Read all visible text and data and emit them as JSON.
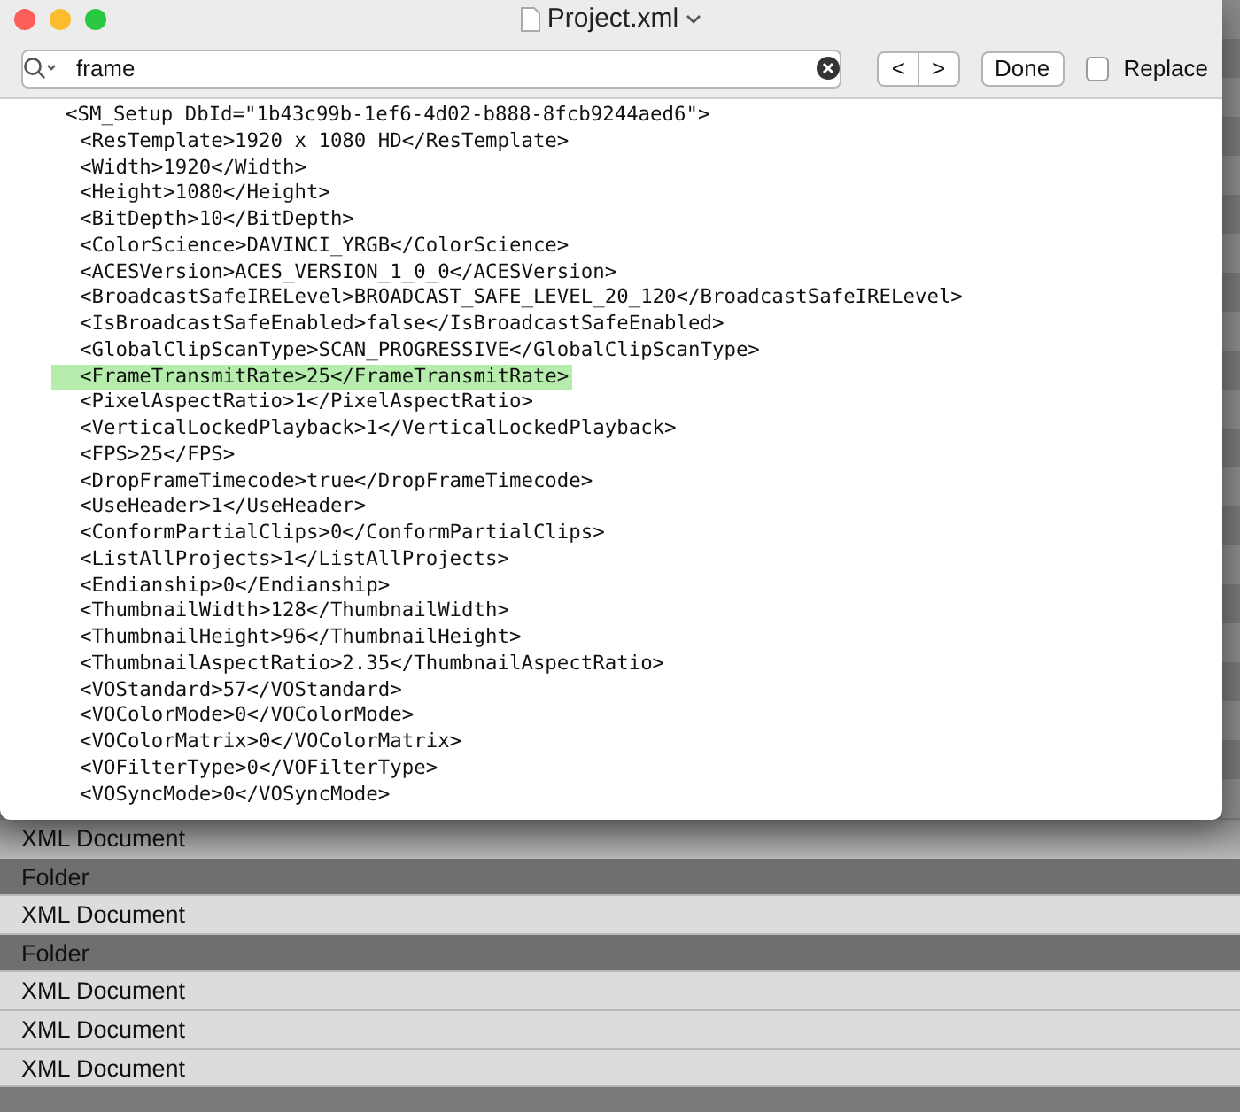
{
  "window": {
    "title": "Project.xml"
  },
  "find_bar": {
    "query": "frame",
    "replace_checked": false,
    "done_label": "Done",
    "replace_label": "Replace",
    "prev_label": "<",
    "next_label": ">"
  },
  "code_lines": [
    {
      "text": "<SM_Setup DbId=\"1b43c99b-1ef6-4d02-b888-8fcb9244aed6\">",
      "highlighted": false,
      "children": [
        {
          "text": "<ResTemplate>1920 x 1080 HD</ResTemplate>",
          "highlighted": false
        },
        {
          "text": "<Width>1920</Width>",
          "highlighted": false
        },
        {
          "text": "<Height>1080</Height>",
          "highlighted": false
        },
        {
          "text": "<BitDepth>10</BitDepth>",
          "highlighted": false
        },
        {
          "text": "<ColorScience>DAVINCI_YRGB</ColorScience>",
          "highlighted": false
        },
        {
          "text": "<ACESVersion>ACES_VERSION_1_0_0</ACESVersion>",
          "highlighted": false
        },
        {
          "text": "<BroadcastSafeIRELevel>BROADCAST_SAFE_LEVEL_20_120</BroadcastSafeIRELevel>",
          "highlighted": false
        },
        {
          "text": "<IsBroadcastSafeEnabled>false</IsBroadcastSafeEnabled>",
          "highlighted": false
        },
        {
          "text": "<GlobalClipScanType>SCAN_PROGRESSIVE</GlobalClipScanType>",
          "highlighted": false
        },
        {
          "text": "<FrameTransmitRate>25</FrameTransmitRate>",
          "highlighted": true
        },
        {
          "text": "<PixelAspectRatio>1</PixelAspectRatio>",
          "highlighted": false
        },
        {
          "text": "<VerticalLockedPlayback>1</VerticalLockedPlayback>",
          "highlighted": false
        },
        {
          "text": "<FPS>25</FPS>",
          "highlighted": false
        },
        {
          "text": "<DropFrameTimecode>true</DropFrameTimecode>",
          "highlighted": false
        },
        {
          "text": "<UseHeader>1</UseHeader>",
          "highlighted": false
        },
        {
          "text": "<ConformPartialClips>0</ConformPartialClips>",
          "highlighted": false
        },
        {
          "text": "<ListAllProjects>1</ListAllProjects>",
          "highlighted": false
        },
        {
          "text": "<Endianship>0</Endianship>",
          "highlighted": false
        },
        {
          "text": "<ThumbnailWidth>128</ThumbnailWidth>",
          "highlighted": false
        },
        {
          "text": "<ThumbnailHeight>96</ThumbnailHeight>",
          "highlighted": false
        },
        {
          "text": "<ThumbnailAspectRatio>2.35</ThumbnailAspectRatio>",
          "highlighted": false
        },
        {
          "text": "<VOStandard>57</VOStandard>",
          "highlighted": false
        },
        {
          "text": "<VOColorMode>0</VOColorMode>",
          "highlighted": false
        },
        {
          "text": "<VOColorMatrix>0</VOColorMatrix>",
          "highlighted": false
        },
        {
          "text": "<VOFilterType>0</VOFilterType>",
          "highlighted": false
        },
        {
          "text": "<VOSyncMode>0</VOSyncMode>",
          "highlighted": false
        }
      ]
    }
  ],
  "file_list": [
    {
      "kind": "XML Document",
      "selected": false
    },
    {
      "kind": "Folder",
      "selected": true
    },
    {
      "kind": "XML Document",
      "selected": false
    },
    {
      "kind": "Folder",
      "selected": true
    },
    {
      "kind": "XML Document",
      "selected": false
    },
    {
      "kind": "XML Document",
      "selected": false
    },
    {
      "kind": "XML Document",
      "selected": false
    }
  ]
}
